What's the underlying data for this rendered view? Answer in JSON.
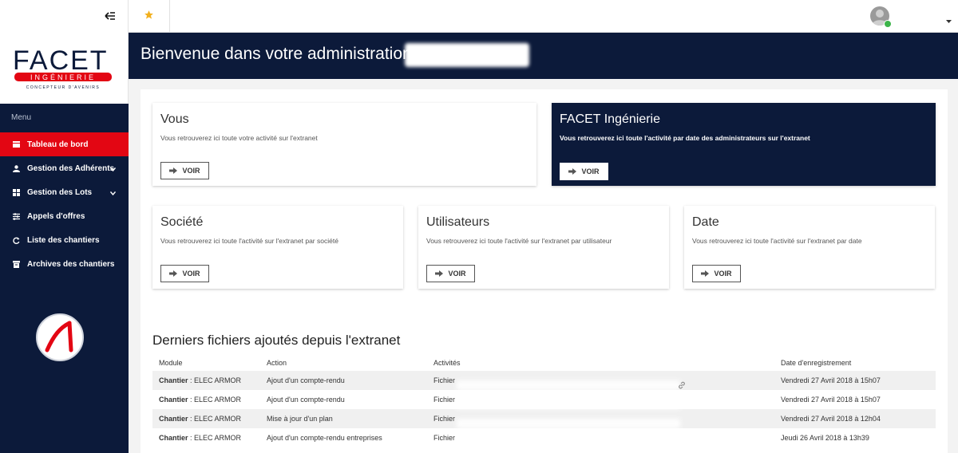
{
  "sidebar": {
    "logo_text": "FACET",
    "logo_sub": "INGÉNIERIE",
    "logo_tagline": "CONCEPTEUR D'AVENIRS",
    "menu_heading": "Menu",
    "items": [
      {
        "label": "Tableau de bord",
        "icon": "dashboard-icon",
        "active": true,
        "has_submenu": false
      },
      {
        "label": "Gestion des Adhérents",
        "icon": "users-icon",
        "active": false,
        "has_submenu": true
      },
      {
        "label": "Gestion des Lots",
        "icon": "grid-icon",
        "active": false,
        "has_submenu": true
      },
      {
        "label": "Appels d'offres",
        "icon": "sliders-icon",
        "active": false,
        "has_submenu": false
      },
      {
        "label": "Liste des chantiers",
        "icon": "refresh-icon",
        "active": false,
        "has_submenu": false
      },
      {
        "label": "Archives des chantiers",
        "icon": "archive-icon",
        "active": false,
        "has_submenu": false
      }
    ]
  },
  "banner": {
    "title": "Bienvenue dans votre administration"
  },
  "cards": [
    {
      "title": "Vous",
      "desc": "Vous retrouverez ici toute votre activité sur l'extranet",
      "button": "VOIR",
      "dark": false
    },
    {
      "title": "FACET Ingénierie",
      "desc": "Vous retrouverez ici toute l'activité par date des administrateurs sur l'extranet",
      "button": "VOIR",
      "dark": true
    },
    {
      "title": "Société",
      "desc": "Vous retrouverez ici toute l'activité sur l'extranet par société",
      "button": "VOIR",
      "dark": false
    },
    {
      "title": "Utilisateurs",
      "desc": "Vous retrouverez ici toute l'activité sur l'extranet par utilisateur",
      "button": "VOIR",
      "dark": false
    },
    {
      "title": "Date",
      "desc": "Vous retrouverez ici toute l'activité sur l'extranet par date",
      "button": "VOIR",
      "dark": false
    }
  ],
  "recent": {
    "title": "Derniers fichiers ajoutés depuis l'extranet",
    "headers": [
      "Module",
      "Action",
      "Activités",
      "Date d'enregistrement"
    ],
    "rows": [
      {
        "module_bold": "Chantier",
        "module": " : ELEC ARMOR",
        "action": "Ajout d'un compte-rendu",
        "activity": "Fichier",
        "date": "Vendredi 27 Avril 2018 à 15h07",
        "link": true
      },
      {
        "module_bold": "Chantier",
        "module": " : ELEC ARMOR",
        "action": "Ajout d'un compte-rendu",
        "activity": "Fichier",
        "date": "Vendredi 27 Avril 2018 à 15h07",
        "link": false
      },
      {
        "module_bold": "Chantier",
        "module": " : ELEC ARMOR",
        "action": "Mise à jour d'un plan",
        "activity": "Fichier",
        "date": "Vendredi 27 Avril 2018 à 12h04",
        "link": false
      },
      {
        "module_bold": "Chantier",
        "module": " : ELEC ARMOR",
        "action": "Ajout d'un compte-rendu entreprises",
        "activity": "Fichier",
        "date": "Jeudi 26 Avril 2018 à 13h39",
        "link": false
      }
    ]
  },
  "colors": {
    "navy": "#0c1a3a",
    "brand_red": "#e30613",
    "star": "#f2b01e",
    "online": "#3cb44a"
  }
}
